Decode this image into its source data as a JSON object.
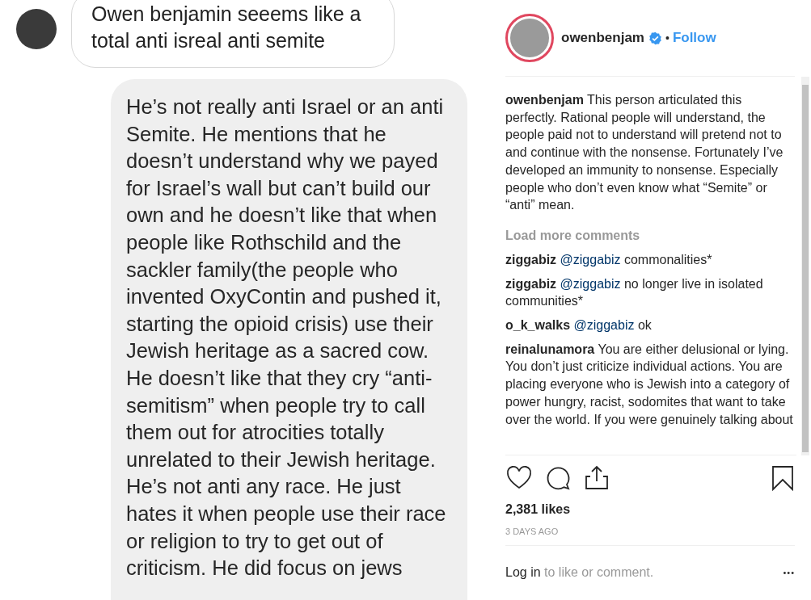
{
  "post_image": {
    "messages": [
      {
        "kind": "incoming",
        "text": "Owen benjamin seeems like a total anti isreal anti semite"
      },
      {
        "kind": "outgoing",
        "text": "He’s not really anti Israel or an anti Semite. He mentions that he doesn’t understand why we payed for Israel’s wall but can’t build our own and he doesn’t like that when people like Rothschild and the sackler family(the people who invented OxyContin and pushed it, starting the opioid crisis) use their Jewish heritage as a sacred cow. He doesn’t like that they cry “anti-semitism” when people try to call them out for atrocities totally unrelated to their Jewish heritage. He’s not anti any race. He just hates it when people use their race or religion to try to get out of criticism. He did focus on jews"
      }
    ]
  },
  "header": {
    "username": "owenbenjam",
    "verified": true,
    "separator": "•",
    "follow": "Follow"
  },
  "caption": {
    "user": "owenbenjam",
    "text": "This person articulated this perfectly. Rational people will understand, the people paid not to understand will pretend not to and continue with the nonsense. Fortunately I’ve developed an immunity to nonsense. Especially people who don’t even know what “Semite” or “anti” mean."
  },
  "load_more": "Load more comments",
  "comments": [
    {
      "user": "ziggabiz",
      "mention": "@ziggabiz",
      "text": "commonalities*"
    },
    {
      "user": "ziggabiz",
      "mention": "@ziggabiz",
      "text": "no longer live in isolated communities*"
    },
    {
      "user": "o_k_walks",
      "mention": "@ziggabiz",
      "text": "ok"
    },
    {
      "user": "reinalunamora",
      "text": "You are either delusional or lying. You don’t just criticize individual actions. You are placing everyone who is Jewish into a category of power hungry, racist, sodomites that want to take over the world. If you were genuinely talking about"
    }
  ],
  "likes": "2,381 likes",
  "date": "3 DAYS AGO",
  "login": {
    "link": "Log in",
    "text": "to like or comment."
  },
  "more": "•••"
}
